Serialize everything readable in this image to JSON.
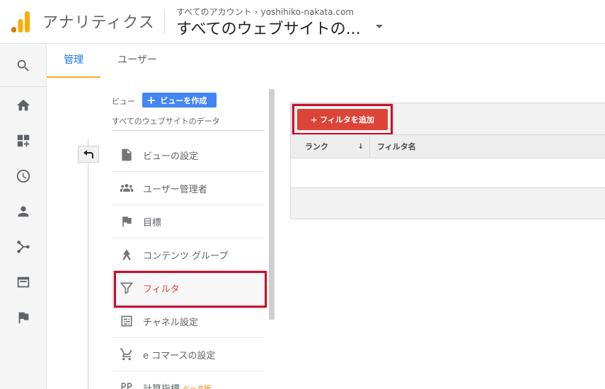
{
  "header": {
    "app_title": "アナリティクス",
    "breadcrumb_root": "すべてのアカウント",
    "breadcrumb_sep": "›",
    "breadcrumb_account": "yoshihiko-nakata.com",
    "property": "すべてのウェブサイトの..."
  },
  "rail": {
    "items": [
      "search-icon",
      "home-icon",
      "dashboard-icon",
      "clock-icon",
      "person-icon",
      "acquisition-icon",
      "behavior-icon",
      "flag-icon"
    ]
  },
  "tabs": [
    {
      "label": "管理",
      "active": true
    },
    {
      "label": "ユーザー",
      "active": false
    }
  ],
  "view_panel": {
    "label": "ビュー",
    "create_view_plus": "+",
    "create_view_label": "ビューを作成",
    "view_name": "すべてのウェブサイトのデータ",
    "menu": [
      {
        "label": "ビューの設定",
        "icon": "document-icon"
      },
      {
        "label": "ユーザー管理者",
        "icon": "users-icon"
      },
      {
        "label": "目標",
        "icon": "flag-icon"
      },
      {
        "label": "コンテンツ グループ",
        "icon": "content-group-icon"
      },
      {
        "label": "フィルタ",
        "icon": "filter-icon",
        "active": true
      },
      {
        "label": "チャネル設定",
        "icon": "channel-icon"
      },
      {
        "label": "e コマースの設定",
        "icon": "cart-icon"
      },
      {
        "label": "計算指標",
        "icon": "calc-icon",
        "badge": "ベータ版"
      }
    ]
  },
  "filters": {
    "add_button": "+ フィルタを追加",
    "columns": {
      "rank": "ランク",
      "rank_sort": "↓",
      "name": "フィルタ名"
    }
  },
  "colors": {
    "accent_blue": "#1a73e8",
    "tab_underline": "#f9a825",
    "filter_red": "#db4437",
    "highlight_red": "#c8102e",
    "create_view_blue": "#4285f4"
  }
}
